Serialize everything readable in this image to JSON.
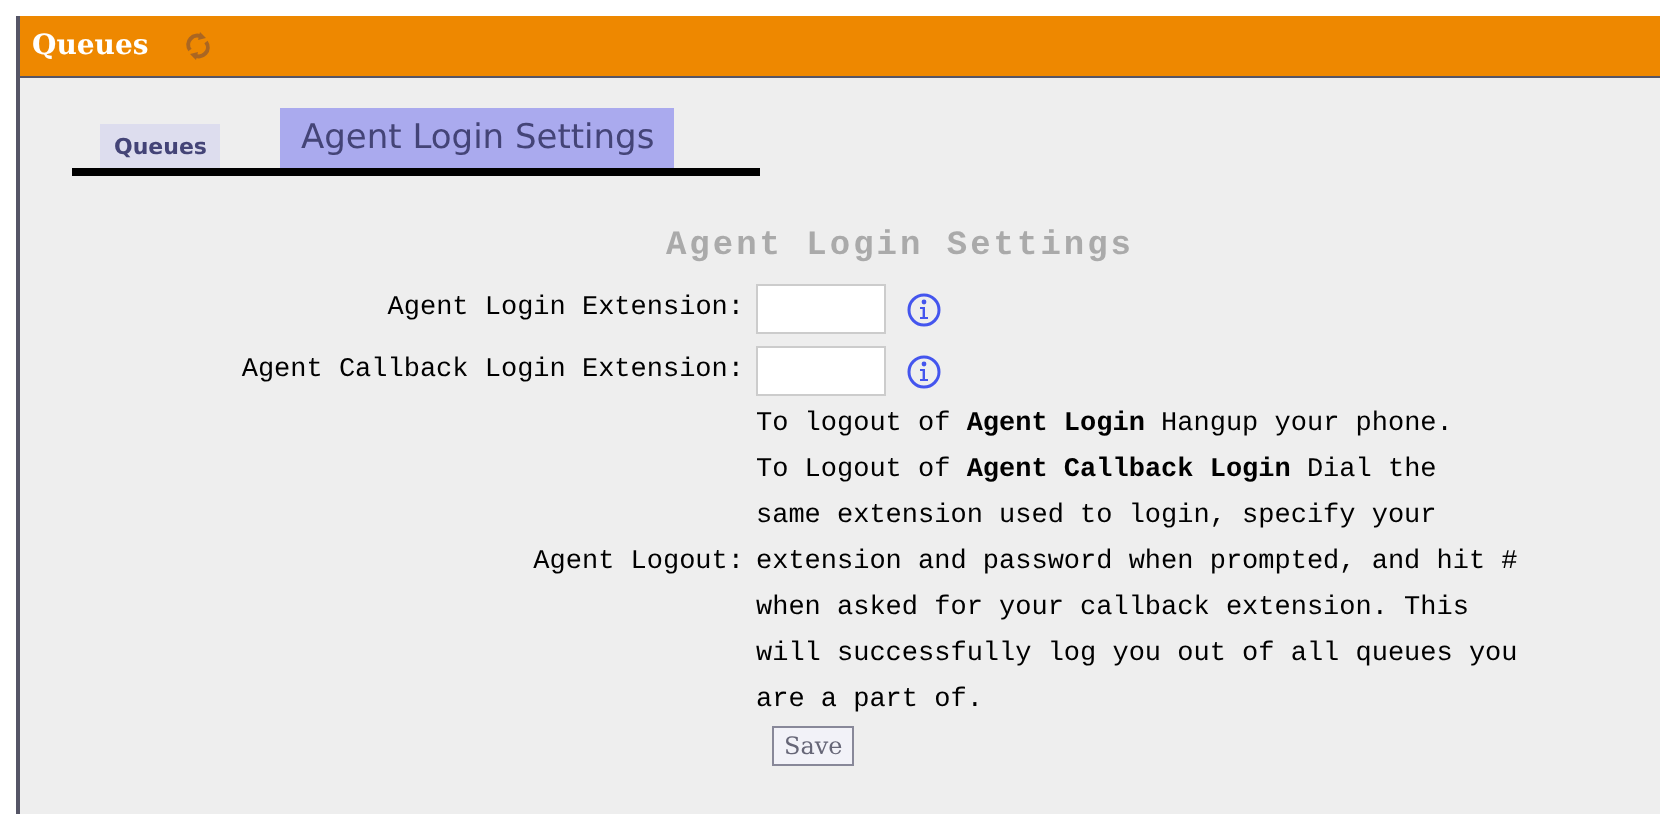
{
  "header": {
    "title": "Queues"
  },
  "tabs": [
    {
      "label": "Queues",
      "selected": false
    },
    {
      "label": "Agent Login Settings",
      "selected": true
    }
  ],
  "form": {
    "title": "Agent Login Settings",
    "fields": [
      {
        "label": "Agent Login Extension:",
        "kind": "text"
      },
      {
        "label": "Agent Callback Login Extension:",
        "kind": "text"
      },
      {
        "label": "Agent Logout:",
        "kind": "note",
        "paragraphs": [
          "To logout of **Agent Login** Hangup your phone.",
          "To Logout of **Agent Callback Login** Dial the\nsame extension used to login, specify your\nextension and password when prompted, and hit #\nwhen asked for your callback extension. This\nwill successfully log you out of all queues you\nare a part of."
        ]
      }
    ],
    "save_button": "Save"
  }
}
